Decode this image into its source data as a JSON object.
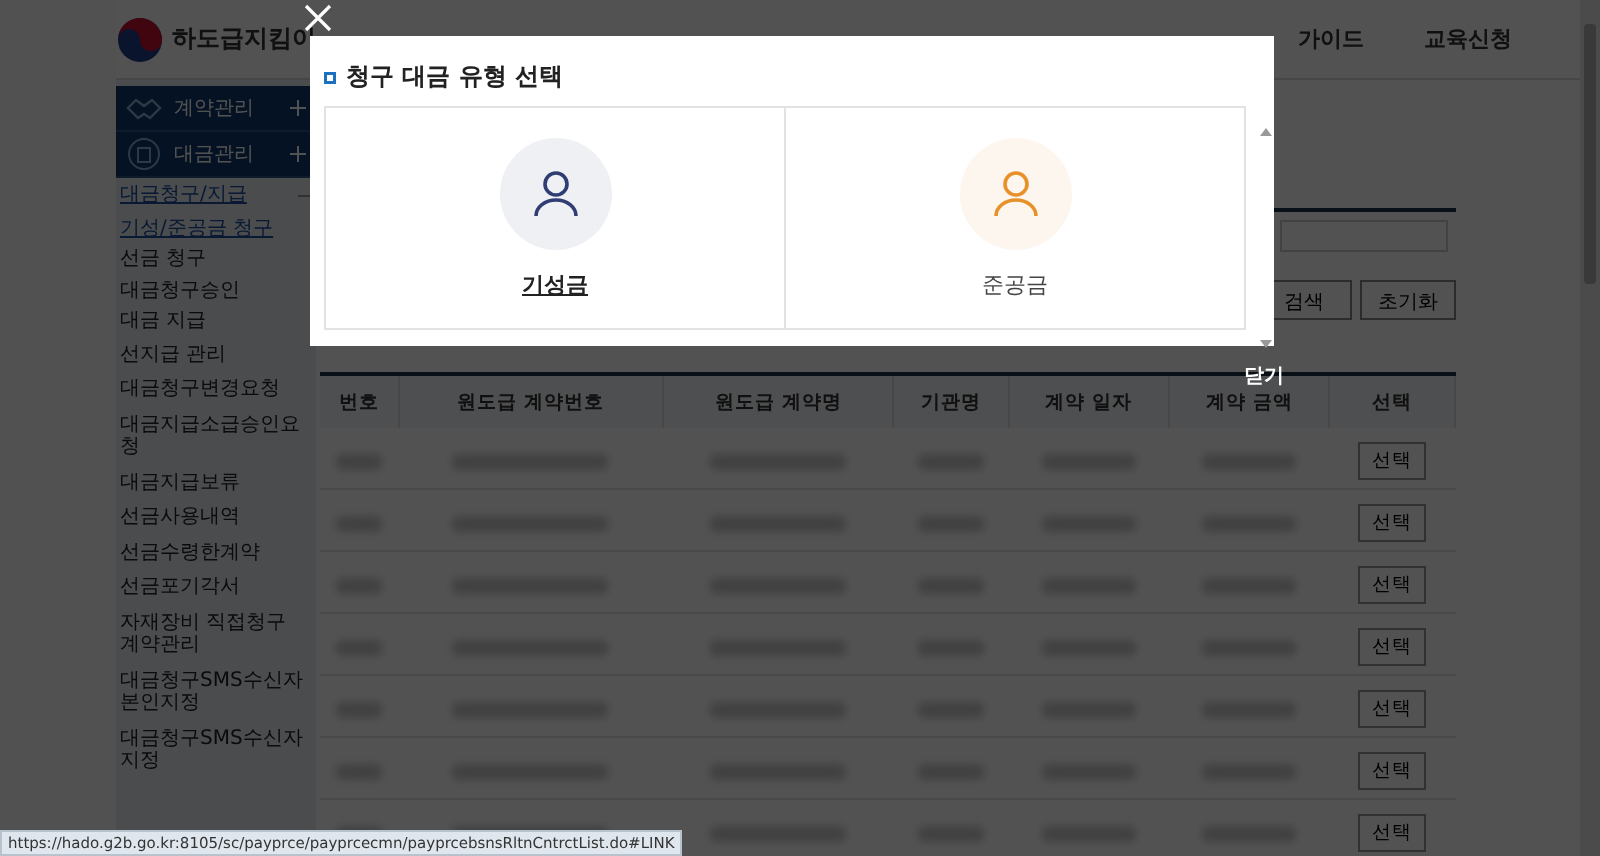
{
  "header": {
    "logo": "하도급지킴이",
    "nav": [
      "가이드",
      "교육신청"
    ]
  },
  "sidebar": {
    "sections": [
      {
        "label": "계약관리",
        "kind": "contract"
      },
      {
        "label": "대금관리",
        "kind": "payment"
      }
    ],
    "items": [
      {
        "label": "대금청구/지급",
        "selected": true,
        "expanded": true,
        "children": [
          {
            "label": "기성/준공금 청구",
            "selected": true
          },
          {
            "label": "선금 청구",
            "selected": false
          },
          {
            "label": "대금청구승인",
            "selected": false
          },
          {
            "label": "대금 지급",
            "selected": false
          }
        ]
      },
      {
        "label": "선지급 관리",
        "selected": false
      },
      {
        "label": "대금청구변경요청",
        "selected": false
      },
      {
        "label": "대금지급소급승인요청",
        "selected": false
      },
      {
        "label": "대금지급보류",
        "selected": false
      },
      {
        "label": "선금사용내역",
        "selected": false
      },
      {
        "label": "선금수령한계약",
        "selected": false
      },
      {
        "label": "선금포기각서",
        "selected": false
      },
      {
        "label": "자재장비 직접청구 계약관리",
        "selected": false
      },
      {
        "label": "대금청구SMS수신자본인지정",
        "selected": false
      },
      {
        "label": "대금청구SMS수신자지정",
        "selected": false
      }
    ]
  },
  "search": {
    "buttons": [
      "검색",
      "초기화"
    ]
  },
  "close_link": "닫기",
  "table": {
    "columns": [
      "번호",
      "원도급 계약번호",
      "원도급 계약명",
      "기관명",
      "계약 일자",
      "계약 금액",
      "선택"
    ],
    "rows": [
      {
        "action": "선택"
      },
      {
        "action": "선택"
      },
      {
        "action": "선택"
      },
      {
        "action": "선택"
      },
      {
        "action": "선택"
      },
      {
        "action": "선택"
      },
      {
        "action": "선택"
      }
    ]
  },
  "modal": {
    "title": "청구 대금 유형 선택",
    "options": [
      {
        "label": "기성금",
        "selected": true,
        "color": "#2f3d73"
      },
      {
        "label": "준공금",
        "selected": false,
        "color": "#e8912a"
      }
    ]
  },
  "status_bar": "https://hado.g2b.go.kr:8105/sc/payprce/payprcecmn/payprcebsnsRltnCntrctList.do#LINK"
}
